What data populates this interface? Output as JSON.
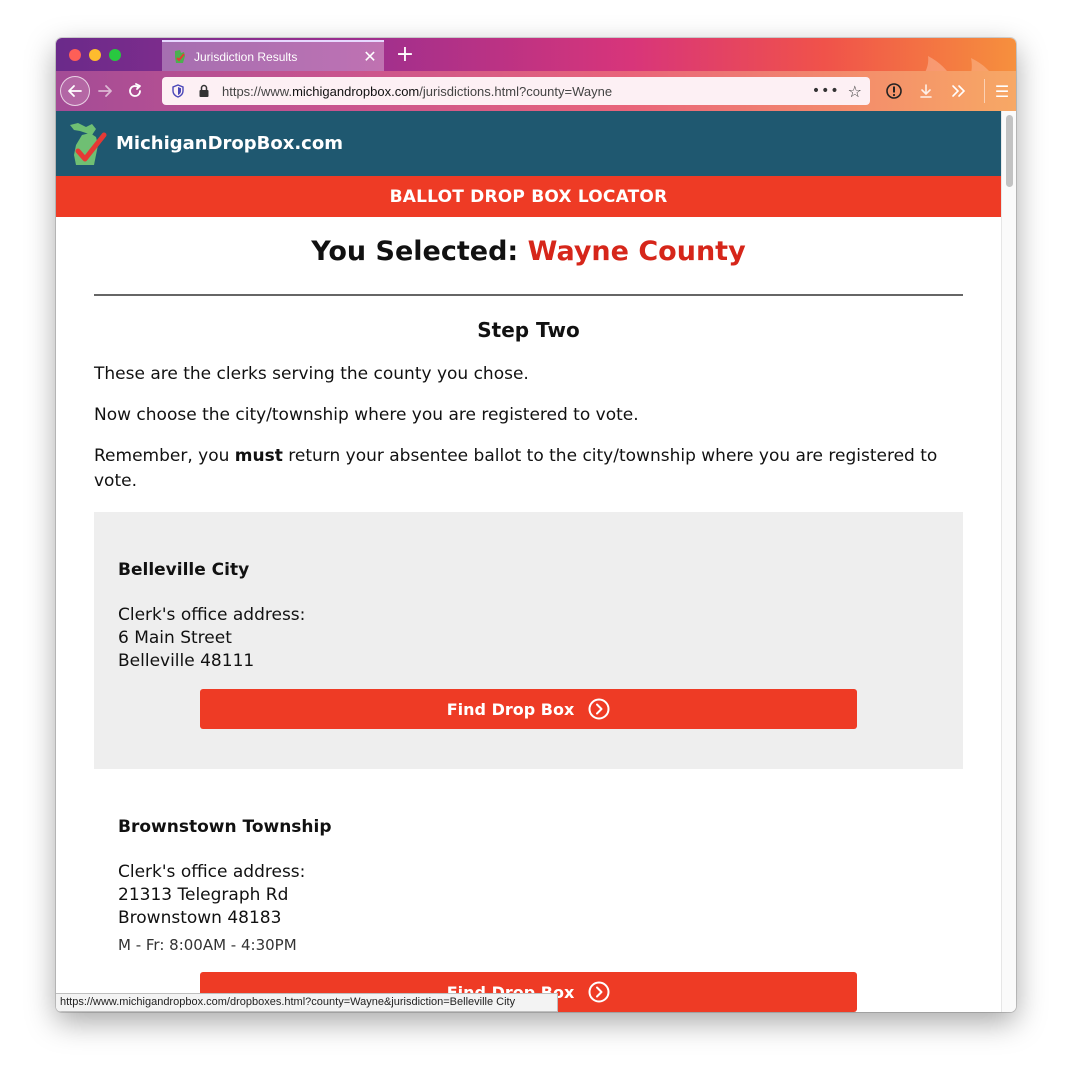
{
  "browser": {
    "tab_title": "Jurisdiction Results",
    "tab_close": "✕",
    "new_tab": "+",
    "url_prefix": "https://www.",
    "url_host": "michigandropbox.com",
    "url_path": "/jurisdictions.html?county=Wayne",
    "status_url": "https://www.michigandropbox.com/dropboxes.html?county=Wayne&jurisdiction=Belleville City",
    "icons": [
      "back-arrow-icon",
      "forward-arrow-icon",
      "reload-icon",
      "shield-icon",
      "lock-icon",
      "page-actions-icon",
      "bookmark-star-icon",
      "info-icon",
      "download-icon",
      "overflow-chevrons-icon",
      "hamburger-menu-icon"
    ]
  },
  "site": {
    "name": "MichiganDropBox.com",
    "banner": "BALLOT DROP BOX LOCATOR"
  },
  "main": {
    "selected_prefix": "You Selected: ",
    "selected_county": "Wayne County",
    "step": "Step Two",
    "p1": "These are the clerks serving the county you chose.",
    "p2": "Now choose the city/township where you are registered to vote.",
    "p3_before": "Remember, you ",
    "p3_bold": "must",
    "p3_after": " return your absentee ballot to the city/township where you are registered to vote."
  },
  "jurisdictions": [
    {
      "name": "Belleville City",
      "label": "Clerk's office address:",
      "street": "6 Main Street",
      "city": "Belleville 48111",
      "button": "Find Drop Box"
    },
    {
      "name": "Brownstown Township",
      "label": "Clerk's office address:",
      "street": "21313 Telegraph Rd",
      "city": "Brownstown 48183",
      "hours": "M - Fr: 8:00AM - 4:30PM",
      "button": "Find Drop Box"
    }
  ],
  "colors": {
    "header_bg": "#1f5870",
    "accent_red": "#ee3b25",
    "county_red": "#d6261a",
    "card_grey": "#eeeeee"
  }
}
